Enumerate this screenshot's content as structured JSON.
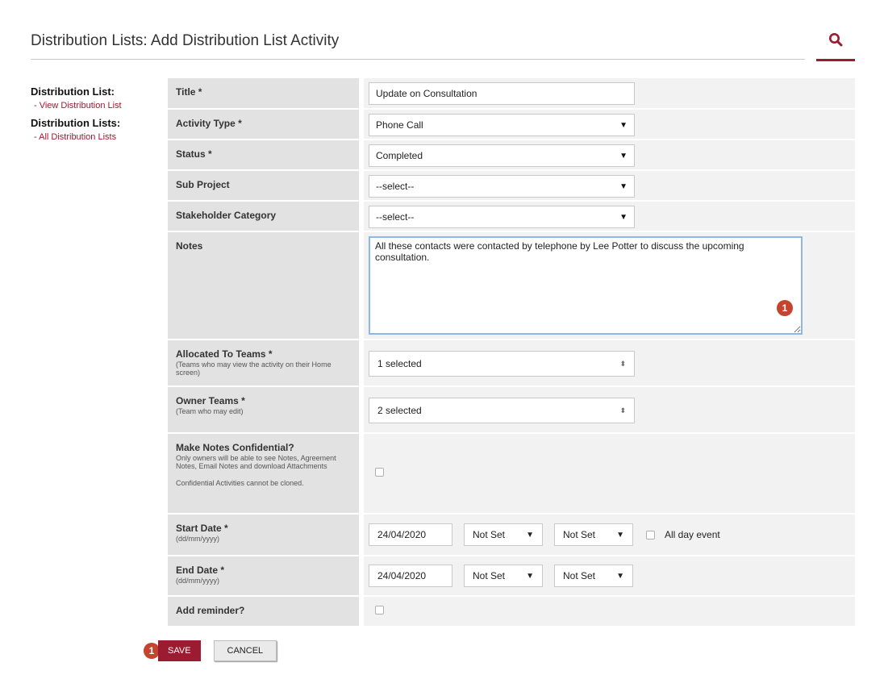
{
  "header": {
    "title": "Distribution Lists: Add Distribution List Activity",
    "search_icon": "search-icon"
  },
  "sidebar": {
    "sections": [
      {
        "heading": "Distribution List:",
        "link": "- View Distribution List"
      },
      {
        "heading": "Distribution Lists:",
        "link": "- All Distribution Lists"
      }
    ]
  },
  "form": {
    "title": {
      "label": "Title *",
      "value": "Update on Consultation"
    },
    "activity_type": {
      "label": "Activity Type *",
      "value": "Phone Call"
    },
    "status": {
      "label": "Status *",
      "value": "Completed"
    },
    "sub_project": {
      "label": "Sub Project",
      "value": "--select--"
    },
    "stakeholder_category": {
      "label": "Stakeholder Category",
      "value": "--select--"
    },
    "notes": {
      "label": "Notes",
      "value": "All these contacts were contacted by telephone by Lee Potter to discuss the upcoming consultation.",
      "badge": "1"
    },
    "allocated_to_teams": {
      "label": "Allocated To Teams *",
      "hint": "(Teams who may view the activity on their Home screen)",
      "value": "1 selected"
    },
    "owner_teams": {
      "label": "Owner Teams *",
      "hint": "(Team who may edit)",
      "value": "2 selected"
    },
    "confidential": {
      "label": "Make Notes Confidential?",
      "hint": "Only owners will be able to see Notes, Agreement Notes, Email Notes and download Attachments",
      "hint2": "Confidential Activities cannot be cloned."
    },
    "start_date": {
      "label": "Start Date *",
      "hint": "(dd/mm/yyyy)",
      "value": "24/04/2020",
      "hour": "Not Set",
      "minute": "Not Set",
      "all_day_label": "All day event"
    },
    "end_date": {
      "label": "End Date *",
      "hint": "(dd/mm/yyyy)",
      "value": "24/04/2020",
      "hour": "Not Set",
      "minute": "Not Set"
    },
    "reminder": {
      "label": "Add reminder?"
    }
  },
  "actions": {
    "badge": "1",
    "save_label": "SAVE",
    "cancel_label": "CANCEL"
  },
  "colors": {
    "brand": "#9b1b30",
    "badge": "#c4442e",
    "focus_border": "#8fb7e6"
  }
}
